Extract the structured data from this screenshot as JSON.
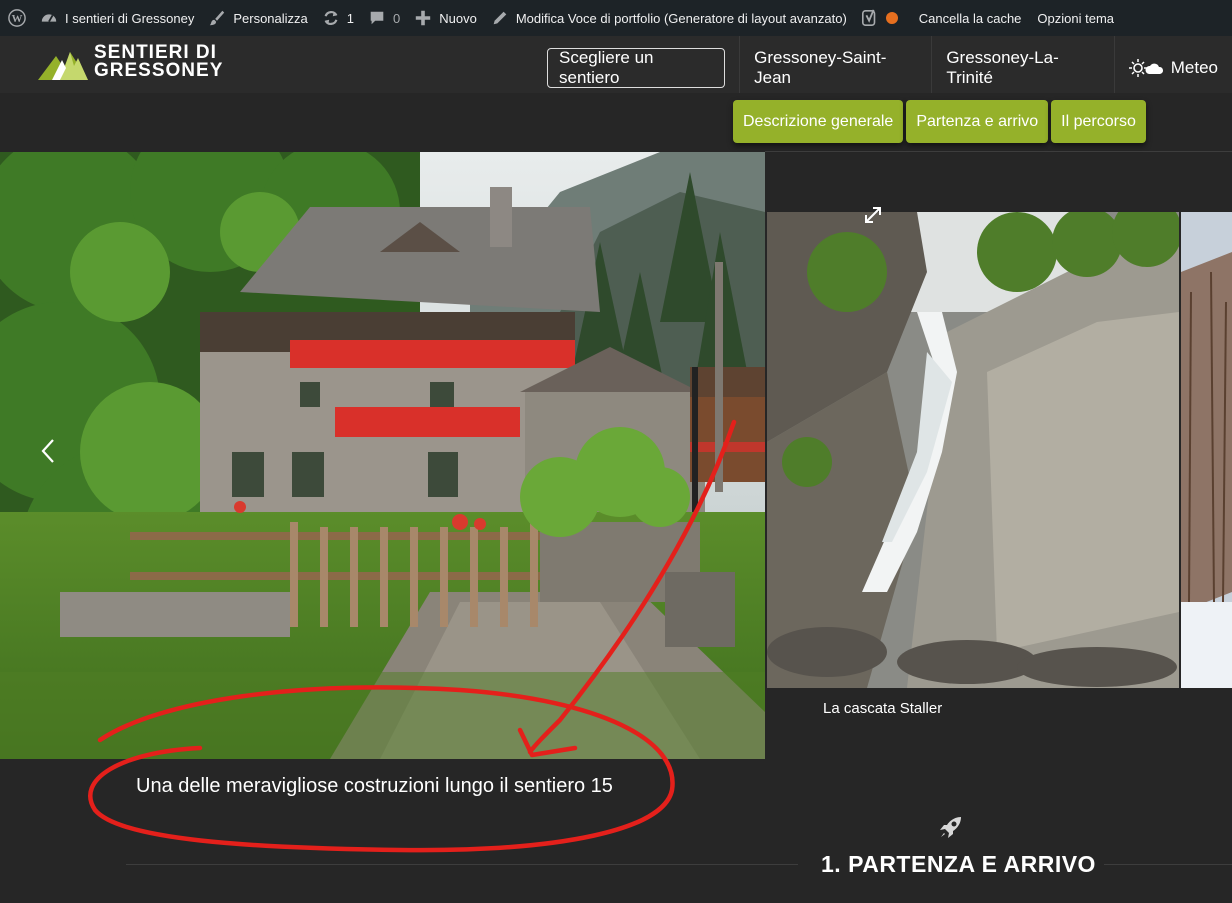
{
  "adminbar": {
    "site_name": "I sentieri di Gressoney",
    "customize": "Personalizza",
    "updates_count": "1",
    "comments_count": "0",
    "new_label": "Nuovo",
    "edit_label": "Modifica Voce di portfolio (Generatore di layout avanzato)",
    "clear_cache": "Cancella la cache",
    "theme_options": "Opzioni tema"
  },
  "header": {
    "logo_line1": "SENTIERI DI",
    "logo_line2": "GRESSONEY",
    "choose_trail": "Scegliere un sentiero",
    "nav": [
      "Gressoney-Saint-Jean",
      "Gressoney-La-Trinité",
      "Meteo"
    ]
  },
  "subnav": [
    "Descrizione generale",
    "Partenza e arrivo",
    "Il percorso"
  ],
  "gallery": {
    "main_caption": "Una delle meravigliose costruzioni lungo il sentiero 15",
    "second_caption": "La cascata Staller"
  },
  "section": {
    "title": "1. PARTENZA E ARRIVO"
  },
  "colors": {
    "accent": "#95b12a",
    "annotation": "#e4201b",
    "adminbar": "#1d2327"
  },
  "icons": [
    "wordpress-icon",
    "dashboard-icon",
    "brush-icon",
    "refresh-icon",
    "comment-icon",
    "plus-icon",
    "pencil-icon",
    "yoast-icon",
    "weather-icon",
    "chevron-left-icon",
    "expand-icon",
    "rocket-icon"
  ]
}
